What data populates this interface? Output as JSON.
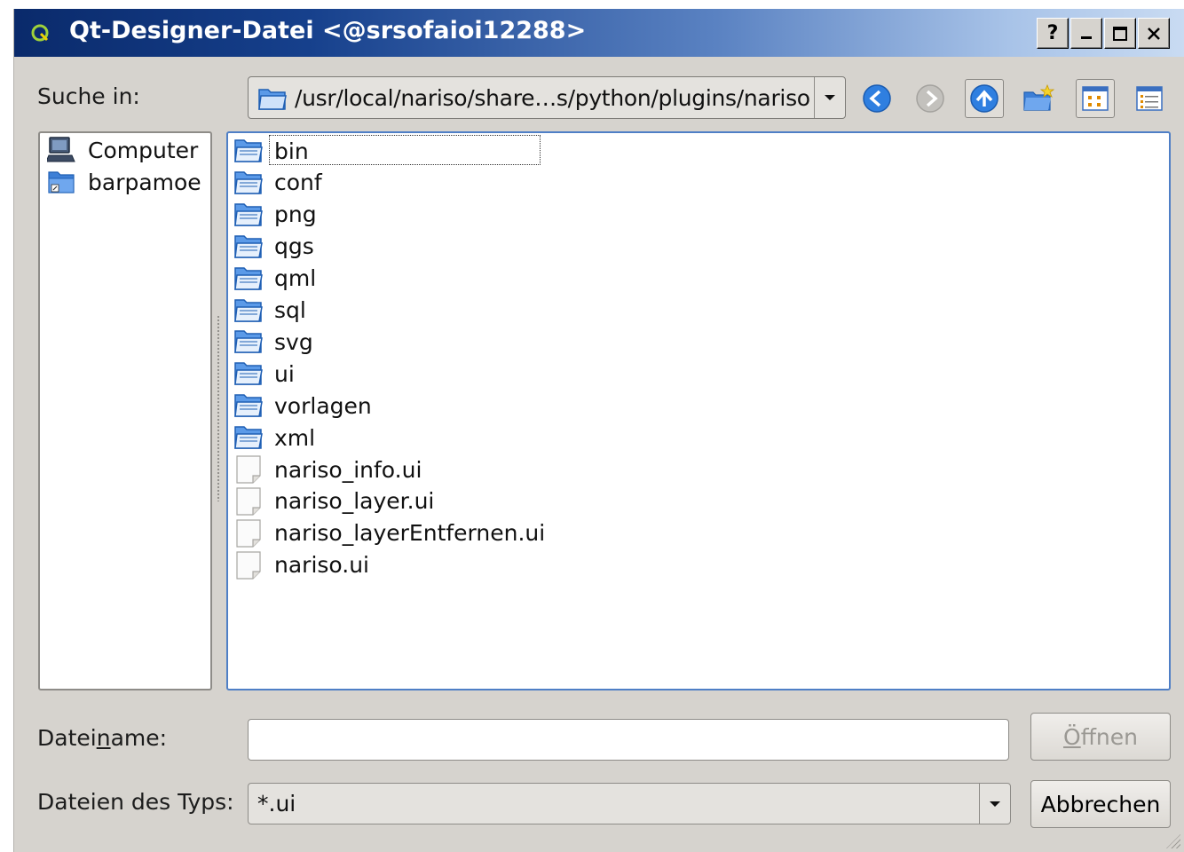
{
  "window": {
    "title": "Qt-Designer-Datei <@srsofaioi12288>",
    "title_buttons": [
      "?",
      "_",
      "☐",
      "✕"
    ]
  },
  "lookin": {
    "label": "Suche in:",
    "path": "/usr/local/nariso/share…s/python/plugins/nariso"
  },
  "sidebar": {
    "items": [
      {
        "label": "Computer",
        "icon": "computer-icon"
      },
      {
        "label": "barpamoe",
        "icon": "home-folder-icon"
      }
    ]
  },
  "files": {
    "items": [
      {
        "name": "bin",
        "type": "folder"
      },
      {
        "name": "conf",
        "type": "folder"
      },
      {
        "name": "png",
        "type": "folder"
      },
      {
        "name": "qgs",
        "type": "folder"
      },
      {
        "name": "qml",
        "type": "folder"
      },
      {
        "name": "sql",
        "type": "folder"
      },
      {
        "name": "svg",
        "type": "folder"
      },
      {
        "name": "ui",
        "type": "folder"
      },
      {
        "name": "vorlagen",
        "type": "folder"
      },
      {
        "name": "xml",
        "type": "folder"
      },
      {
        "name": "nariso_info.ui",
        "type": "file"
      },
      {
        "name": "nariso_layer.ui",
        "type": "file"
      },
      {
        "name": "nariso_layerEntfernen.ui",
        "type": "file"
      },
      {
        "name": "nariso.ui",
        "type": "file"
      }
    ]
  },
  "filename": {
    "label_pre": "Datei",
    "label_mnemonic": "n",
    "label_post": "ame:",
    "value": ""
  },
  "filetype": {
    "label": "Dateien des Typs:",
    "value": "*.ui"
  },
  "buttons": {
    "open_mnemonic": "Ö",
    "open_rest": "ffnen",
    "cancel": "Abbrechen"
  },
  "colors": {
    "accent": "#4f7fc6",
    "folder": "#3d7fd6"
  }
}
